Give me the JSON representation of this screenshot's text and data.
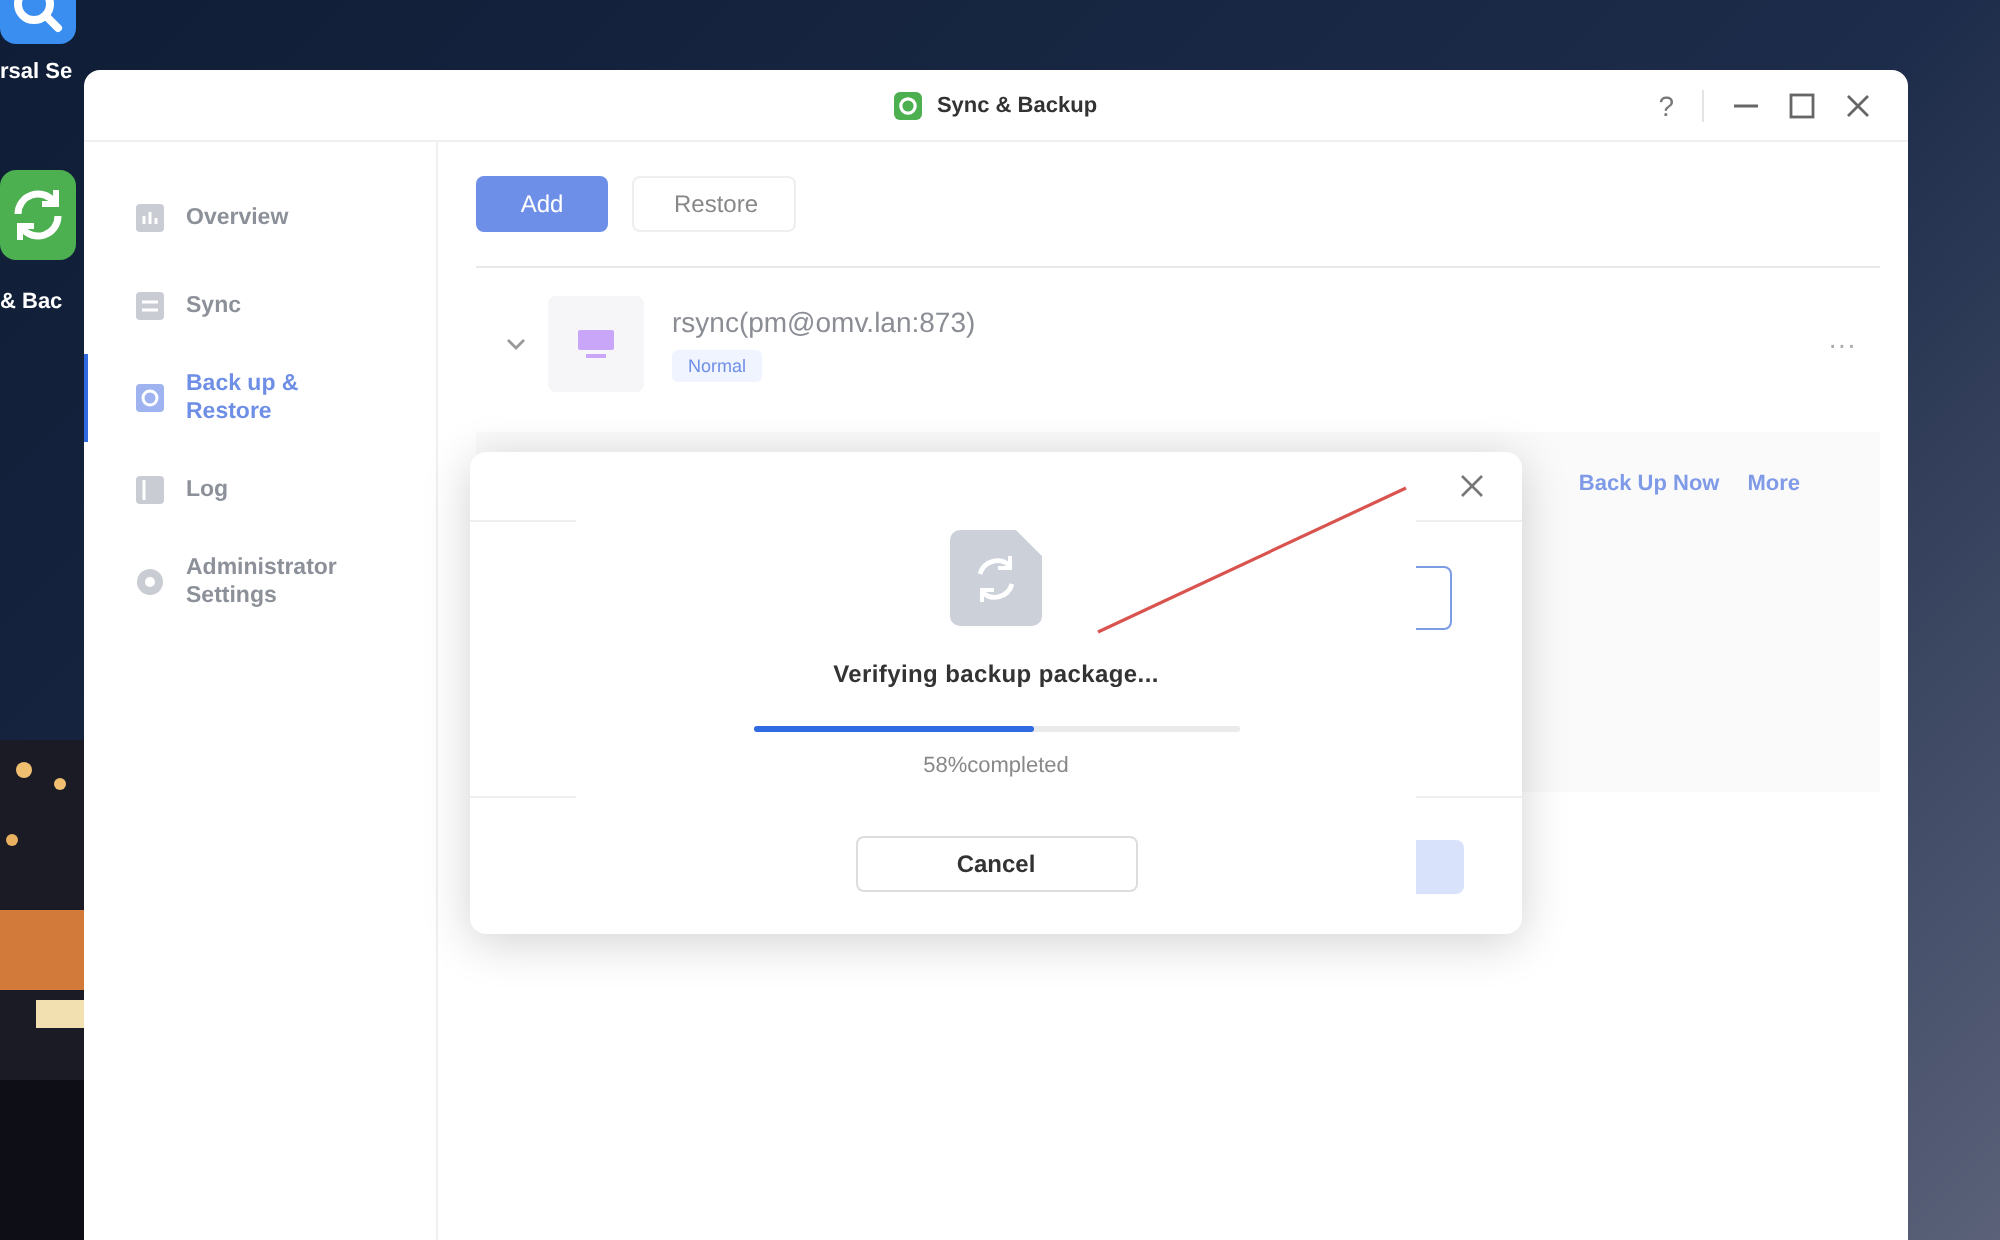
{
  "desktop": {
    "icons": [
      {
        "kind": "search",
        "label": "rsal Se"
      },
      {
        "kind": "sync",
        "label": "& Bac"
      }
    ]
  },
  "window": {
    "title": "Sync & Backup",
    "help": "?"
  },
  "sidebar": {
    "items": [
      {
        "kind": "overview",
        "label": "Overview",
        "selected": false
      },
      {
        "kind": "sync",
        "label": "Sync",
        "selected": false
      },
      {
        "kind": "backup",
        "label": "Back up & Restore",
        "selected": true
      },
      {
        "kind": "log",
        "label": "Log",
        "selected": false
      },
      {
        "kind": "settings",
        "label": "Administrator Settings",
        "selected": false
      }
    ]
  },
  "toolbar": {
    "buttons": [
      {
        "kind": "primary",
        "label": "Add"
      },
      {
        "kind": "secondary",
        "label": "Restore"
      }
    ]
  },
  "task": {
    "name": "rsync(pm@omv.lan:873)",
    "status": "Normal",
    "expanded": true,
    "more": "···",
    "actions": [
      "Back Up Now",
      "More"
    ]
  },
  "progress_dialog": {
    "message": "Verifying backup package...",
    "level": 0.58,
    "reading": "58%completed",
    "cancel": "Cancel"
  }
}
